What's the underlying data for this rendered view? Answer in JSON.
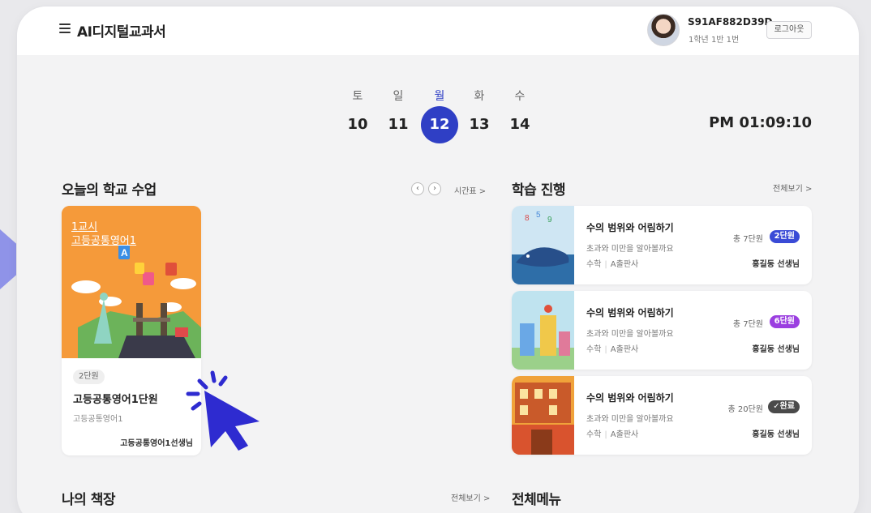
{
  "header": {
    "menu_icon": "hamburger-icon",
    "title": "AI디지털교과서",
    "user_id": "S91AF882D39D",
    "user_class": "1학년 1반 1번",
    "logout_label": "로그아웃"
  },
  "calendar": {
    "days": [
      {
        "label": "토",
        "num": "10"
      },
      {
        "label": "일",
        "num": "11"
      },
      {
        "label": "월",
        "num": "12"
      },
      {
        "label": "화",
        "num": "13"
      },
      {
        "label": "수",
        "num": "14"
      }
    ],
    "selected_index": 2,
    "clock": "PM 01:09:10"
  },
  "school_classes": {
    "title": "오늘의 학교 수업",
    "prev_icon": "chevron-left-icon",
    "next_icon": "chevron-right-icon",
    "timetable_link": "시간표 >",
    "card": {
      "period": "1교시",
      "subject_link": "고등공통영어1",
      "unit_badge": "2단원",
      "title": "고등공통영어1단원",
      "subtitle": "고등공통영어1",
      "teacher": "고등공통영어1선생님"
    }
  },
  "learning_progress": {
    "title": "학습 진행",
    "view_all": "전체보기 >",
    "items": [
      {
        "title": "수의 범위와 어림하기",
        "subtitle": "초과와 미만을 알아볼까요",
        "subject": "수학",
        "publisher": "A출판사",
        "total": "총 7단원",
        "badge": "2단원",
        "badge_color": "#3a4bd6",
        "teacher": "홍길동 선생님"
      },
      {
        "title": "수의 범위와 어림하기",
        "subtitle": "초과와 미만을 알아볼까요",
        "subject": "수학",
        "publisher": "A출판사",
        "total": "총 7단원",
        "badge": "6단원",
        "badge_color": "#9b3fe0",
        "teacher": "홍길동 선생님"
      },
      {
        "title": "수의 범위와 어림하기",
        "subtitle": "초과와 미만을 알아볼까요",
        "subject": "수학",
        "publisher": "A출판사",
        "total": "총 20단원",
        "badge": "완료",
        "badge_color": "#4a4a4a",
        "teacher": "홍길동 선생님"
      }
    ]
  },
  "bookshelf": {
    "title": "나의 책장",
    "view_all": "전체보기 >"
  },
  "all_menu": {
    "title": "전체메뉴"
  }
}
